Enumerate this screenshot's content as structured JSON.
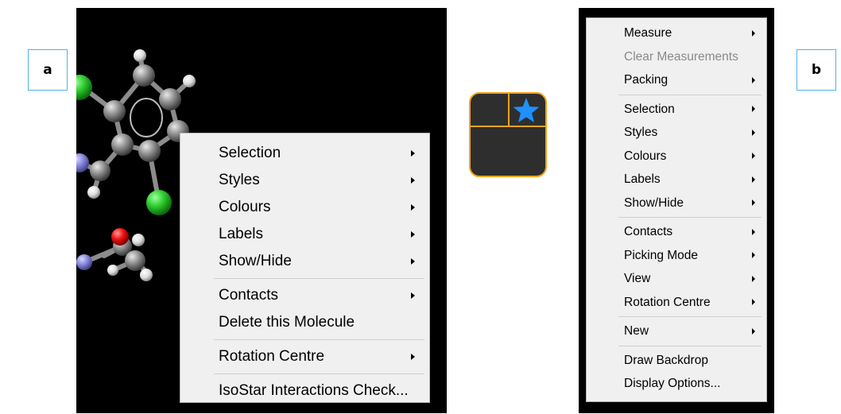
{
  "panel_labels": {
    "a": "a",
    "b": "b"
  },
  "menu_a": {
    "items": [
      {
        "label": "Selection",
        "submenu": true
      },
      {
        "label": "Styles",
        "submenu": true
      },
      {
        "label": "Colours",
        "submenu": true
      },
      {
        "label": "Labels",
        "submenu": true
      },
      {
        "label": "Show/Hide",
        "submenu": true
      },
      {
        "label": "Contacts",
        "submenu": true
      },
      {
        "label": "Delete this Molecule",
        "submenu": false
      },
      {
        "label": "Rotation Centre",
        "submenu": true
      },
      {
        "label": "IsoStar Interactions Check...",
        "submenu": false
      }
    ]
  },
  "menu_b": {
    "items": [
      {
        "label": "Measure",
        "submenu": true
      },
      {
        "label": "Clear Measurements",
        "submenu": false,
        "disabled": true
      },
      {
        "label": "Packing",
        "submenu": true
      },
      {
        "label": "Selection",
        "submenu": true
      },
      {
        "label": "Styles",
        "submenu": true
      },
      {
        "label": "Colours",
        "submenu": true
      },
      {
        "label": "Labels",
        "submenu": true
      },
      {
        "label": "Show/Hide",
        "submenu": true
      },
      {
        "label": "Contacts",
        "submenu": true
      },
      {
        "label": "Picking Mode",
        "submenu": true
      },
      {
        "label": "View",
        "submenu": true
      },
      {
        "label": "Rotation Centre",
        "submenu": true
      },
      {
        "label": "New",
        "submenu": true
      },
      {
        "label": "Draw Backdrop",
        "submenu": false
      },
      {
        "label": "Display Options...",
        "submenu": false
      }
    ]
  },
  "icons": {
    "layout": "window-layout-icon",
    "star": "star-icon"
  },
  "colors": {
    "accent_orange": "#f2a31a",
    "star_blue": "#1e90ff",
    "label_border": "#4fb3e6",
    "viewer_bg": "#000000",
    "menu_bg": "#f0f0f0"
  }
}
